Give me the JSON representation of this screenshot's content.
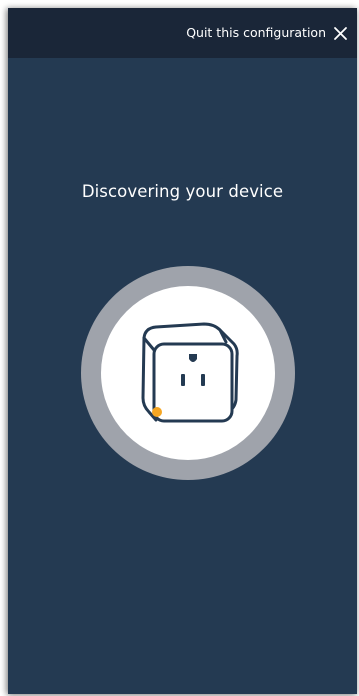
{
  "header": {
    "quit_label": "Quit this configuration",
    "close_icon": "close-icon"
  },
  "main": {
    "title": "Discovering your device",
    "device_icon": "smart-plug-icon",
    "indicator_color": "#f5a623"
  },
  "colors": {
    "background": "#243a52",
    "header": "#1a2638",
    "ring": "#9fa3ab",
    "disc": "#ffffff",
    "device_outline": "#243a52"
  }
}
